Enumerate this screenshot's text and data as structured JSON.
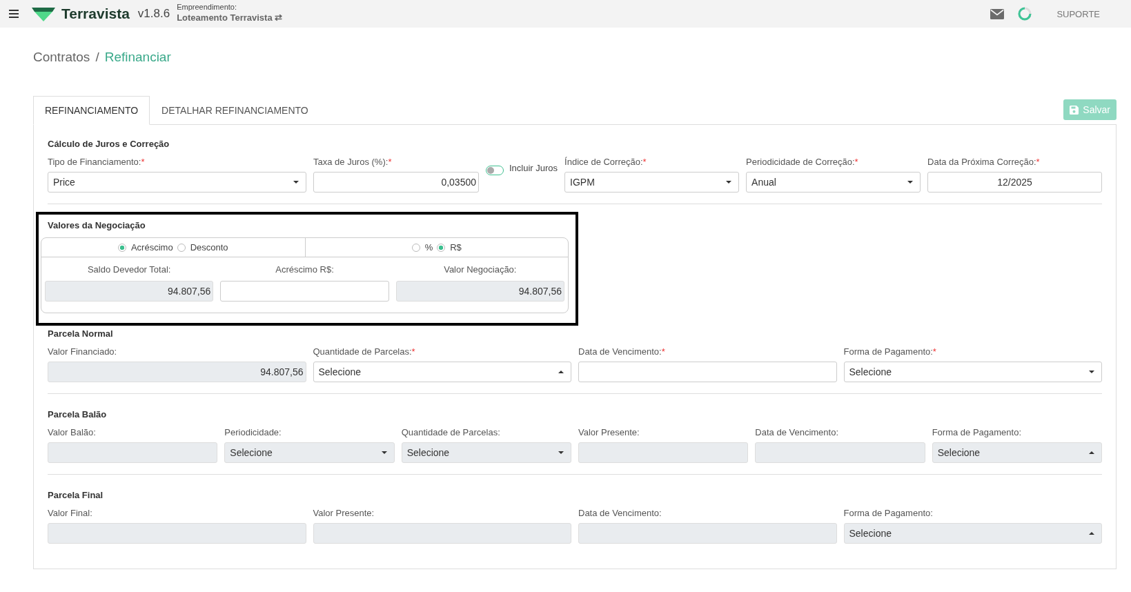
{
  "topbar": {
    "brand": "Terravista",
    "version": "v1.8.6",
    "project_label": "Empreendimento:",
    "project_name": "Loteamento Terravista",
    "project_switch": "⇄",
    "support": "SUPORTE"
  },
  "breadcrumb": [
    {
      "label": "Contratos",
      "selected": false
    },
    {
      "label": "Refinanciar",
      "selected": true
    }
  ],
  "breadcrumb_separator": "/",
  "tabs": [
    {
      "label": "REFINANCIAMENTO",
      "selected": true
    },
    {
      "label": "DETALHAR REFINANCIAMENTO",
      "selected": false
    }
  ],
  "save_button": {
    "label": "Salvar",
    "disabled": true
  },
  "sections": [
    {
      "title": "Cálculo de Juros e Correção",
      "kind": "calc",
      "fields": [
        {
          "kind": "select",
          "label": "Tipo de Financiamento:",
          "required_mark": "*",
          "value": "Price",
          "disabled": false,
          "expanded": false
        },
        {
          "kind": "number",
          "label": "Taxa de Juros (%):",
          "required_mark": "*",
          "value": "0,03500",
          "disabled": false
        },
        {
          "kind": "toggle",
          "label": "Incluir Juros",
          "on": false
        },
        {
          "kind": "select",
          "label": "Índice de Correção:",
          "required_mark": "*",
          "value": "IGPM",
          "disabled": false,
          "expanded": false
        },
        {
          "kind": "select",
          "label": "Periodicidade de Correção:",
          "required_mark": "*",
          "value": "Anual",
          "disabled": false,
          "expanded": false
        },
        {
          "kind": "date",
          "label": "Data da Próxima Correção:",
          "required_mark": "*",
          "value": "12/2025",
          "disabled": false
        }
      ]
    },
    {
      "title": "Valores da Negociação",
      "kind": "negotiation",
      "highlighted": true,
      "adjustment": [
        {
          "label": "Acréscimo",
          "selected": true
        },
        {
          "label": "Desconto",
          "selected": false
        }
      ],
      "unit": [
        {
          "label": "%",
          "selected": false
        },
        {
          "label": "R$",
          "selected": true
        }
      ],
      "fields": [
        {
          "kind": "number",
          "label": "Saldo Devedor Total:",
          "value": "94.807,56",
          "disabled": true
        },
        {
          "kind": "number",
          "label": "Acréscimo R$:",
          "disabled": false
        },
        {
          "kind": "number",
          "label": "Valor Negociação:",
          "value": "94.807,56",
          "disabled": true
        }
      ]
    },
    {
      "title": "Parcela Normal",
      "kind": "grid",
      "fields": [
        {
          "kind": "number",
          "label": "Valor Financiado:",
          "value": "94.807,56",
          "disabled": true
        },
        {
          "kind": "select",
          "label": "Quantidade de Parcelas:",
          "required_mark": "*",
          "value": "Selecione",
          "disabled": false,
          "expanded": true
        },
        {
          "kind": "date",
          "label": "Data de Vencimento:",
          "required_mark": "*",
          "disabled": false
        },
        {
          "kind": "select",
          "label": "Forma de Pagamento:",
          "required_mark": "*",
          "value": "Selecione",
          "disabled": false,
          "expanded": false
        }
      ]
    },
    {
      "title": "Parcela Balão",
      "kind": "grid",
      "fields": [
        {
          "kind": "number",
          "label": "Valor Balão:",
          "disabled": true
        },
        {
          "kind": "select",
          "label": "Periodicidade:",
          "value": "Selecione",
          "disabled": true,
          "expanded": false
        },
        {
          "kind": "select",
          "label": "Quantidade de Parcelas:",
          "value": "Selecione",
          "disabled": true,
          "expanded": false
        },
        {
          "kind": "number",
          "label": "Valor Presente:",
          "disabled": true
        },
        {
          "kind": "date",
          "label": "Data de Vencimento:",
          "disabled": true
        },
        {
          "kind": "select",
          "label": "Forma de Pagamento:",
          "value": "Selecione",
          "disabled": true,
          "expanded": true
        }
      ]
    },
    {
      "title": "Parcela Final",
      "kind": "grid",
      "fields": [
        {
          "kind": "number",
          "label": "Valor Final:",
          "disabled": true
        },
        {
          "kind": "number",
          "label": "Valor Presente:",
          "disabled": true
        },
        {
          "kind": "date",
          "label": "Data de Vencimento:",
          "disabled": true
        },
        {
          "kind": "select",
          "label": "Forma de Pagamento:",
          "value": "Selecione",
          "disabled": true,
          "expanded": true
        }
      ]
    }
  ]
}
